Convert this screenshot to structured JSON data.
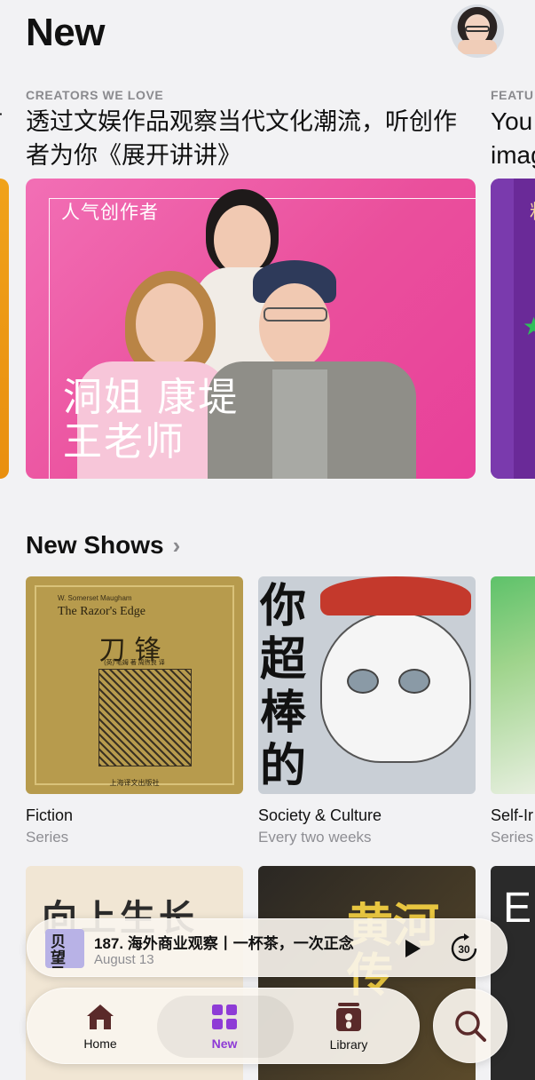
{
  "header": {
    "title": "New"
  },
  "featured": [
    {
      "eyebrow": "CREATORS WE LOVE",
      "title": "透过文娱作品观察当代文化潮流，听创作者为你《展开讲讲》",
      "card_tag": "人气创作者",
      "card_names_line1": "洞姐 康堤",
      "card_names_line2": "王老师"
    },
    {
      "eyebrow": "FEATU",
      "title_line1": "You",
      "title_line2": "imag"
    }
  ],
  "left_peek_title_glyph": "Ŧ",
  "new_shows": {
    "title": "New Shows",
    "items": [
      {
        "name": "Fiction",
        "subtitle": "Series",
        "art_author": "W. Somerset Maugham",
        "art_title_en": "The Razor's Edge",
        "art_title_cn": "刀锋",
        "art_credits": "(英) 毛姆 著  周煦良 译",
        "art_publisher": "上海译文出版社"
      },
      {
        "name": "Society & Culture",
        "subtitle": "Every two weeks",
        "art_text": "你超棒的"
      },
      {
        "name": "Self-Ir",
        "subtitle": "Series"
      }
    ],
    "row2": [
      {
        "art_text": "向上生长"
      },
      {
        "art_text": "黄河传"
      },
      {
        "art_text": "E"
      }
    ]
  },
  "mini_player": {
    "art_text": "贝望录",
    "title": "187. 海外商业观察丨一杯茶，一次正念",
    "date": "August 13"
  },
  "tab_bar": {
    "tabs": [
      {
        "label": "Home",
        "icon": "house-icon"
      },
      {
        "label": "New",
        "icon": "grid-icon"
      },
      {
        "label": "Library",
        "icon": "library-icon"
      }
    ],
    "active": "New",
    "accent": "#8e3bd6"
  },
  "colors": {
    "featured_card": "#ea4f9c",
    "background": "#f2f2f4"
  }
}
